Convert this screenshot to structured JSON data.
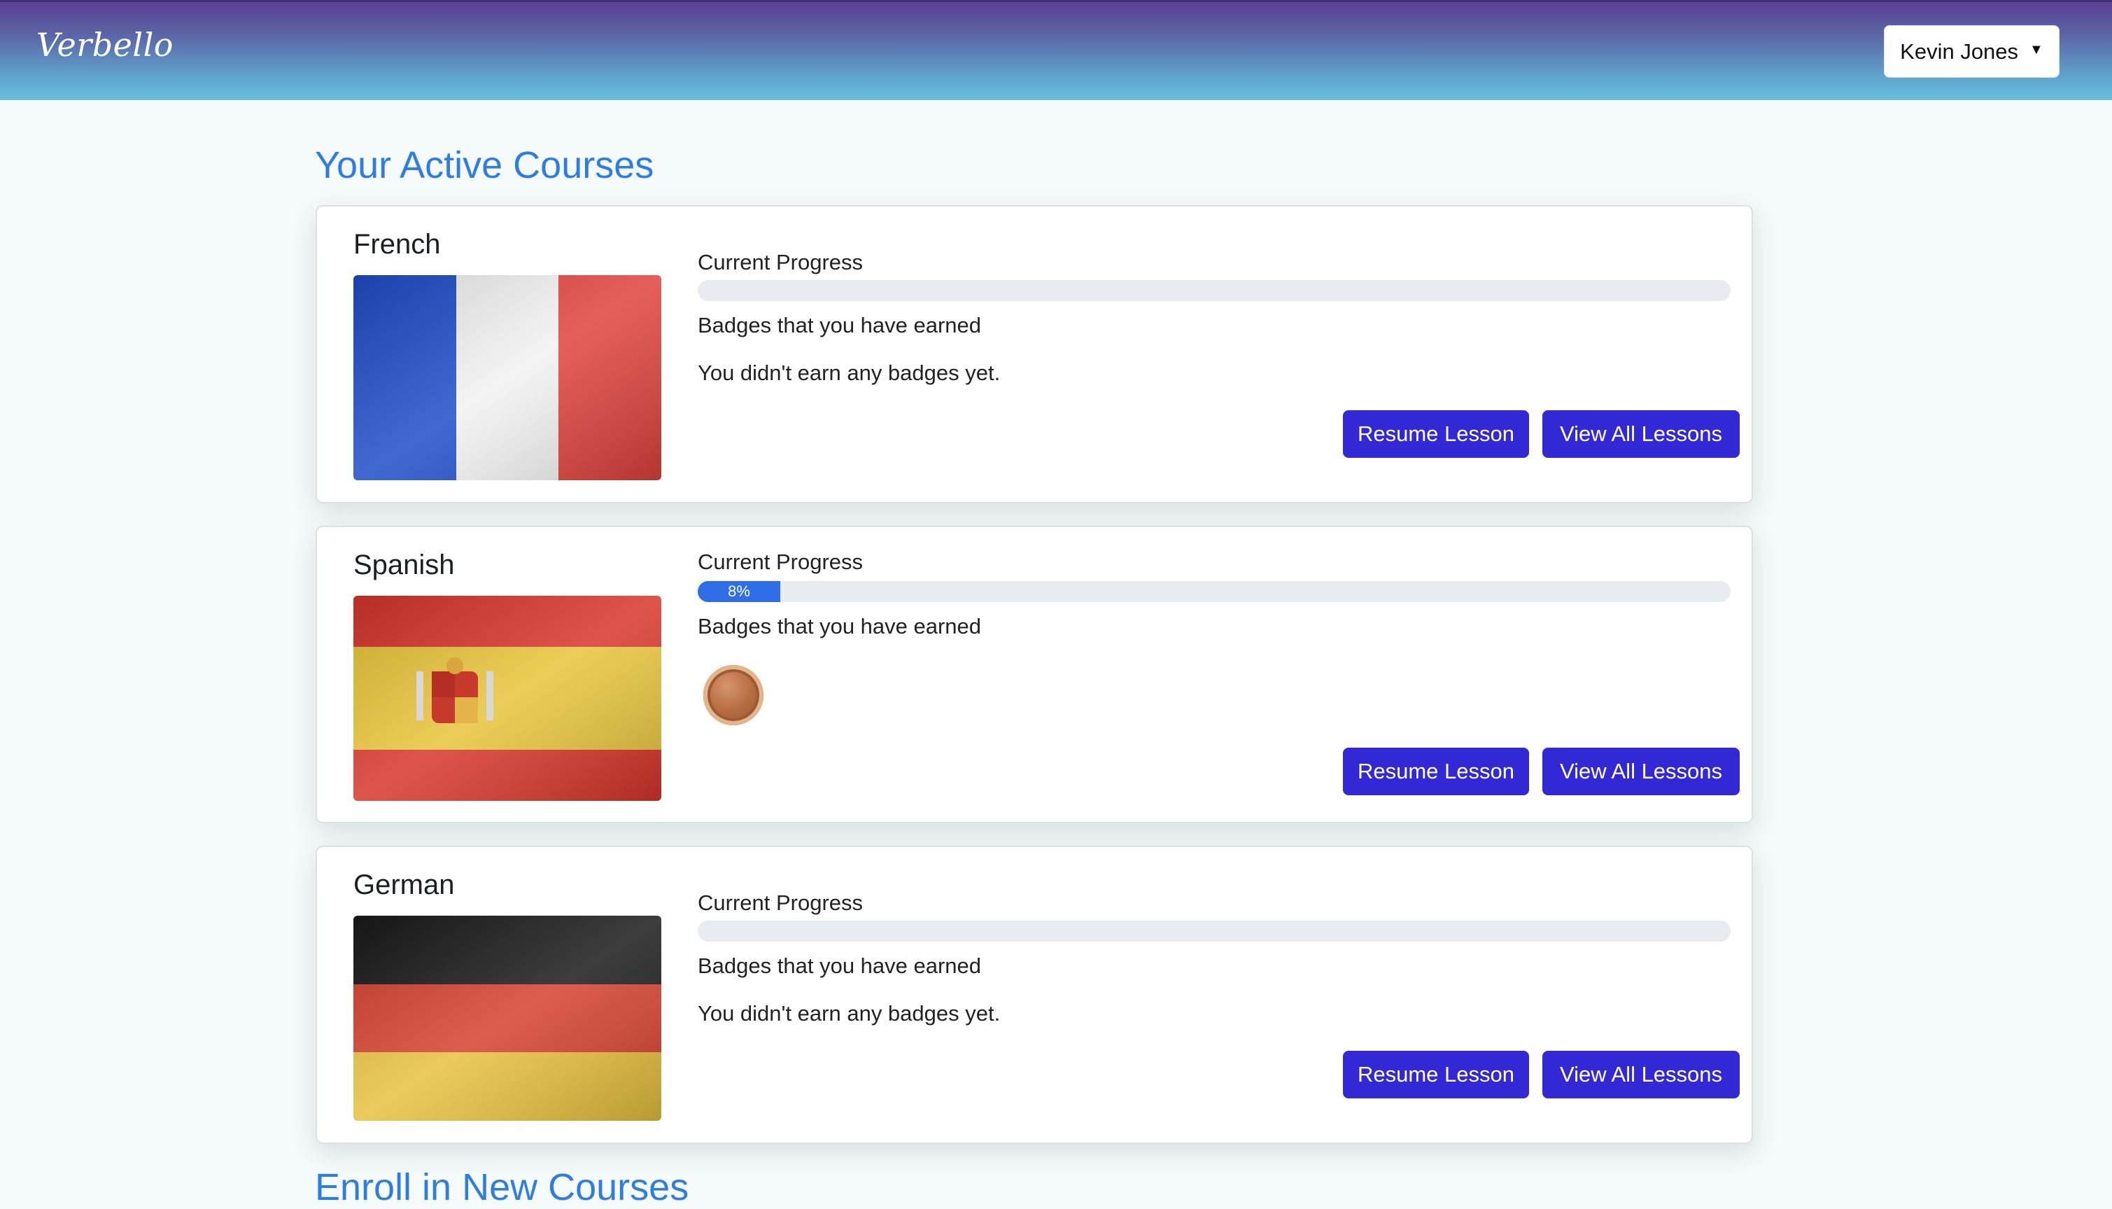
{
  "app": {
    "brand": "Verbello"
  },
  "user": {
    "name": "Kevin Jones"
  },
  "sections": {
    "active_title": "Your Active Courses",
    "enroll_title": "Enroll in New Courses"
  },
  "courses": [
    {
      "name": "French",
      "progress_label": "Current Progress",
      "progress_value": 0,
      "progress_text": "",
      "badges_label": "Badges that you have earned",
      "no_badges_text": "You didn't earn any badges yet.",
      "resume_label": "Resume Lesson",
      "view_label": "View All Lessons"
    },
    {
      "name": "Spanish",
      "progress_label": "Current Progress",
      "progress_value": 0.08,
      "progress_text": "8%",
      "badges_label": "Badges that you have earned",
      "badges": [
        "bronze-medal-icon"
      ],
      "resume_label": "Resume Lesson",
      "view_label": "View All Lessons"
    },
    {
      "name": "German",
      "progress_label": "Current Progress",
      "progress_value": 0,
      "progress_text": "",
      "badges_label": "Badges that you have earned",
      "no_badges_text": "You didn't earn any badges yet.",
      "resume_label": "Resume Lesson",
      "view_label": "View All Lessons"
    }
  ],
  "colors": {
    "accent": "#2f7de1",
    "button": "#3228d6",
    "progress_fill": "#2f6ee6",
    "page_bg": "#f5fbfa"
  }
}
